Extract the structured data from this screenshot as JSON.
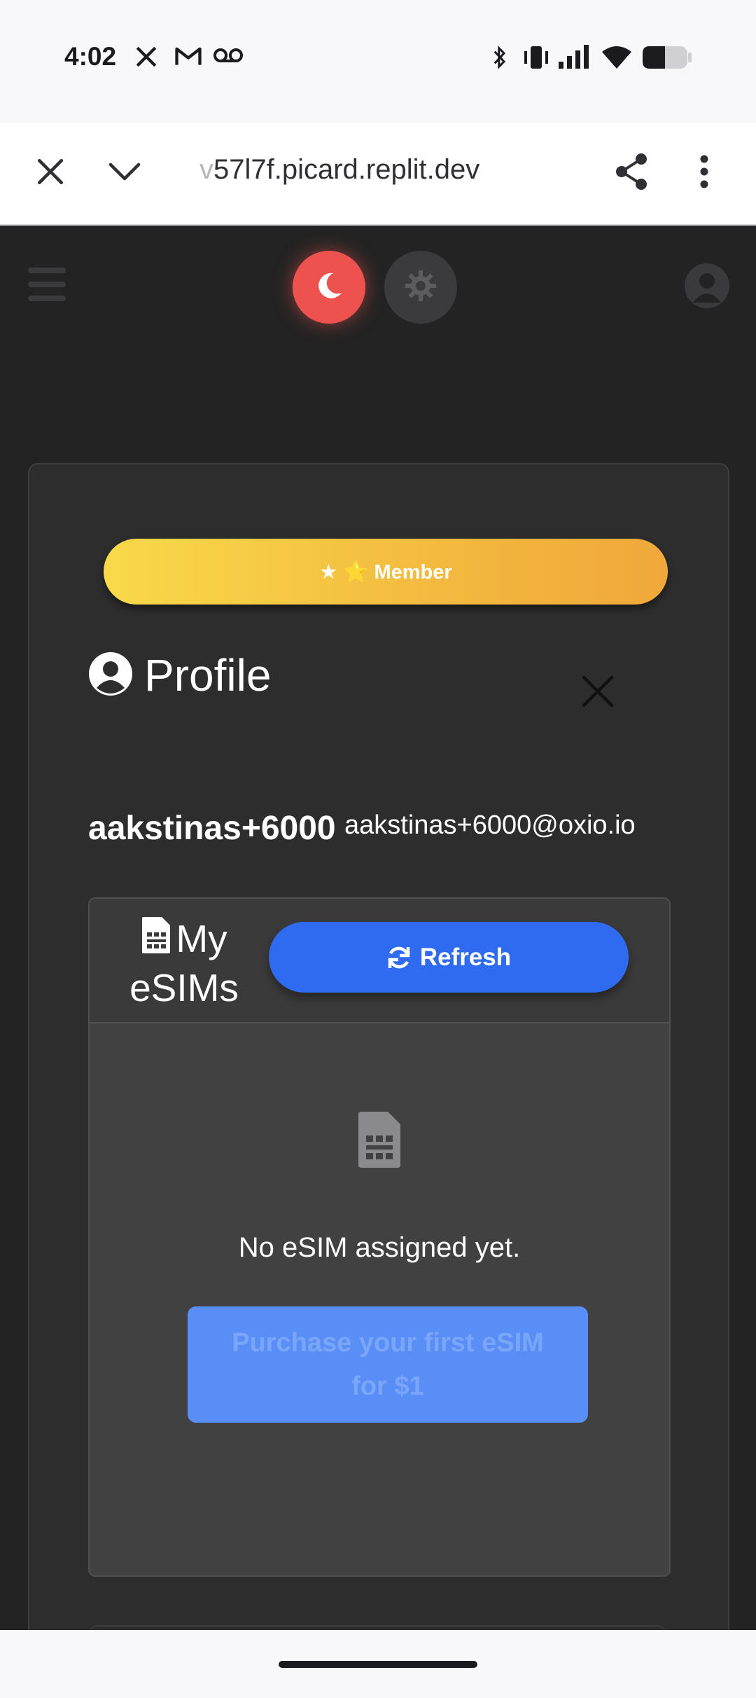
{
  "status_bar": {
    "time": "4:02",
    "left_icons": [
      "x-app-icon",
      "gmail-icon",
      "voicemail-icon"
    ],
    "right_icons": [
      "bluetooth-icon",
      "vibrate-icon",
      "signal-icon",
      "wifi-icon",
      "battery-icon"
    ]
  },
  "browser": {
    "url_fade": "v",
    "url": "57l7f.picard.replit.dev",
    "close_icon": "close-icon",
    "dropdown_icon": "chevron-down-icon",
    "share_icon": "share-icon",
    "menu_icon": "more-vert-icon"
  },
  "topnav": {
    "menu_icon": "hamburger-icon",
    "dark_theme_icon": "moon-icon",
    "light_theme_icon": "gear-icon",
    "account_icon": "user-circle-icon",
    "accent_dark": "#ee524f"
  },
  "profile": {
    "badge": "★ ⭐ Member",
    "title": "Profile",
    "username": "aakstinas+6000",
    "email": "aakstinas+6000@oxio.io"
  },
  "esims": {
    "title_line1": "My",
    "title_line2": "eSIMs",
    "refresh_label": "Refresh",
    "empty_message": "No eSIM assigned yet.",
    "purchase_line1": "Purchase your first eSIM",
    "purchase_line2": "for $1",
    "accent": "#2f6bf0"
  }
}
